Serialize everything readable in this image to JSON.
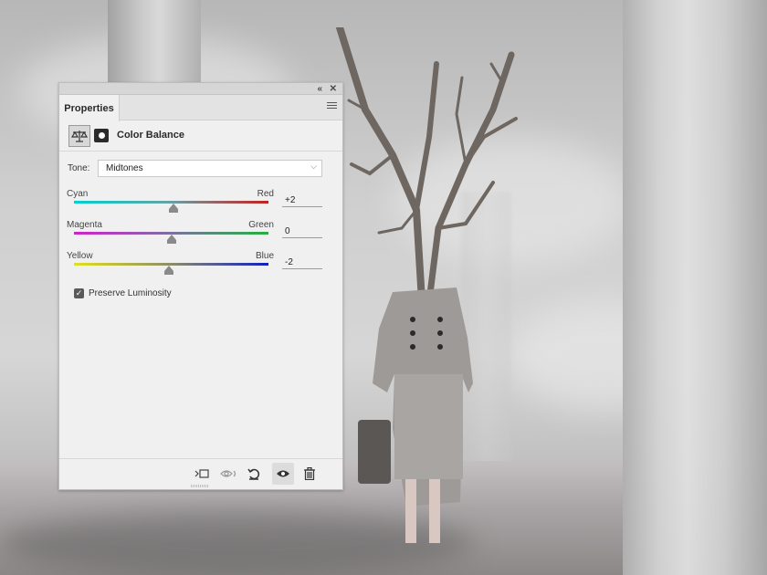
{
  "panel": {
    "tab_label": "Properties",
    "adjustment_title": "Color Balance",
    "tone": {
      "label": "Tone:",
      "value": "Midtones"
    },
    "sliders": [
      {
        "left_label": "Cyan",
        "right_label": "Red",
        "value": "+2",
        "level": 2
      },
      {
        "left_label": "Magenta",
        "right_label": "Green",
        "value": "0",
        "level": 0
      },
      {
        "left_label": "Yellow",
        "right_label": "Blue",
        "value": "-2",
        "level": -2
      }
    ],
    "slider_range": [
      -100,
      100
    ],
    "preserve_luminosity": {
      "label": "Preserve Luminosity",
      "checked": true
    },
    "bottom_buttons": [
      "clip-to-layer-icon",
      "view-previous-state-icon",
      "reset-icon",
      "visibility-eye-icon",
      "trash-icon"
    ]
  }
}
